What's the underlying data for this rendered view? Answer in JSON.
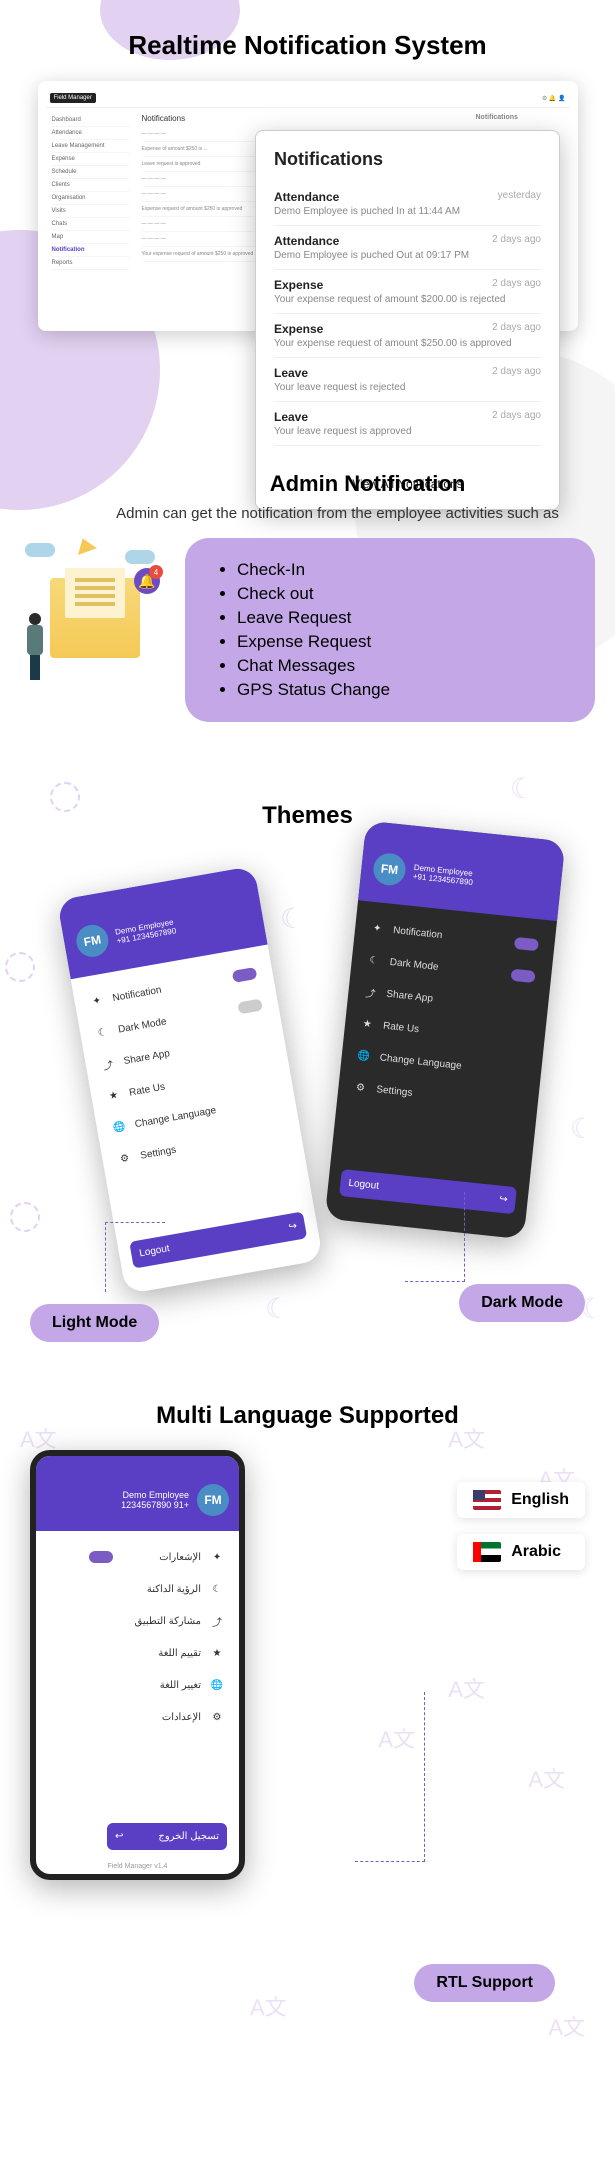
{
  "section1": {
    "title": "Realtime Notification System",
    "dashboard": {
      "brand": "Field Manager",
      "sidebarItems": [
        "Dashboard",
        "Attendance",
        "Leave Management",
        "Expense",
        "Schedule",
        "Clients",
        "Organisation",
        "Visits",
        "Chats",
        "Map",
        "Notification",
        "Reports"
      ],
      "mainHeader": "Notifications",
      "sidePanel": "Notifications"
    },
    "notifCard": {
      "title": "Notifications",
      "items": [
        {
          "cat": "Attendance",
          "time": "yesterday",
          "desc": "Demo Employee is puched In at 11:44 AM"
        },
        {
          "cat": "Attendance",
          "time": "2 days ago",
          "desc": "Demo Employee is puched Out at 09:17 PM"
        },
        {
          "cat": "Expense",
          "time": "2 days ago",
          "desc": "Your expense request of amount $200.00 is rejected"
        },
        {
          "cat": "Expense",
          "time": "2 days ago",
          "desc": "Your expense request of amount $250.00 is approved"
        },
        {
          "cat": "Leave",
          "time": "2 days ago",
          "desc": "Your leave request is rejected"
        },
        {
          "cat": "Leave",
          "time": "2 days ago",
          "desc": "Your leave request is approved"
        }
      ],
      "footer": "View All Notifications"
    }
  },
  "section2": {
    "title": "Admin Notification",
    "subtitle": "Admin can get the notification from the employee activities such as",
    "items": [
      "Check-In",
      "Check out",
      "Leave Request",
      "Expense Request",
      "Chat Messages",
      "GPS Status Change"
    ],
    "bellCount": "4"
  },
  "section3": {
    "title": "Themes",
    "user": "Demo Employee",
    "phone": "+91 1234567890",
    "drawer": {
      "notification": "Notification",
      "darkMode": "Dark Mode",
      "share": "Share App",
      "rate": "Rate Us",
      "lang": "Change Language",
      "settings": "Settings"
    },
    "logout": "Logout",
    "avatarInit": "FM",
    "lightLabel": "Light Mode",
    "darkLabel": "Dark Mode"
  },
  "section4": {
    "title": "Multi Language Supported",
    "user": "Demo Employee",
    "phone": "1234567890 91+",
    "rtlItems": [
      "الإشعارات",
      "الرؤية الداكنة",
      "مشاركة التطبيق",
      "تقييم اللغة",
      "تغيير اللغة",
      "الإعدادات"
    ],
    "rtlLogout": "تسجيل الخروج",
    "footerText": "Field Manager v1.4",
    "langs": {
      "en": "English",
      "ar": "Arabic"
    },
    "rtlLabel": "RTL Support",
    "langIcon": "A文"
  }
}
